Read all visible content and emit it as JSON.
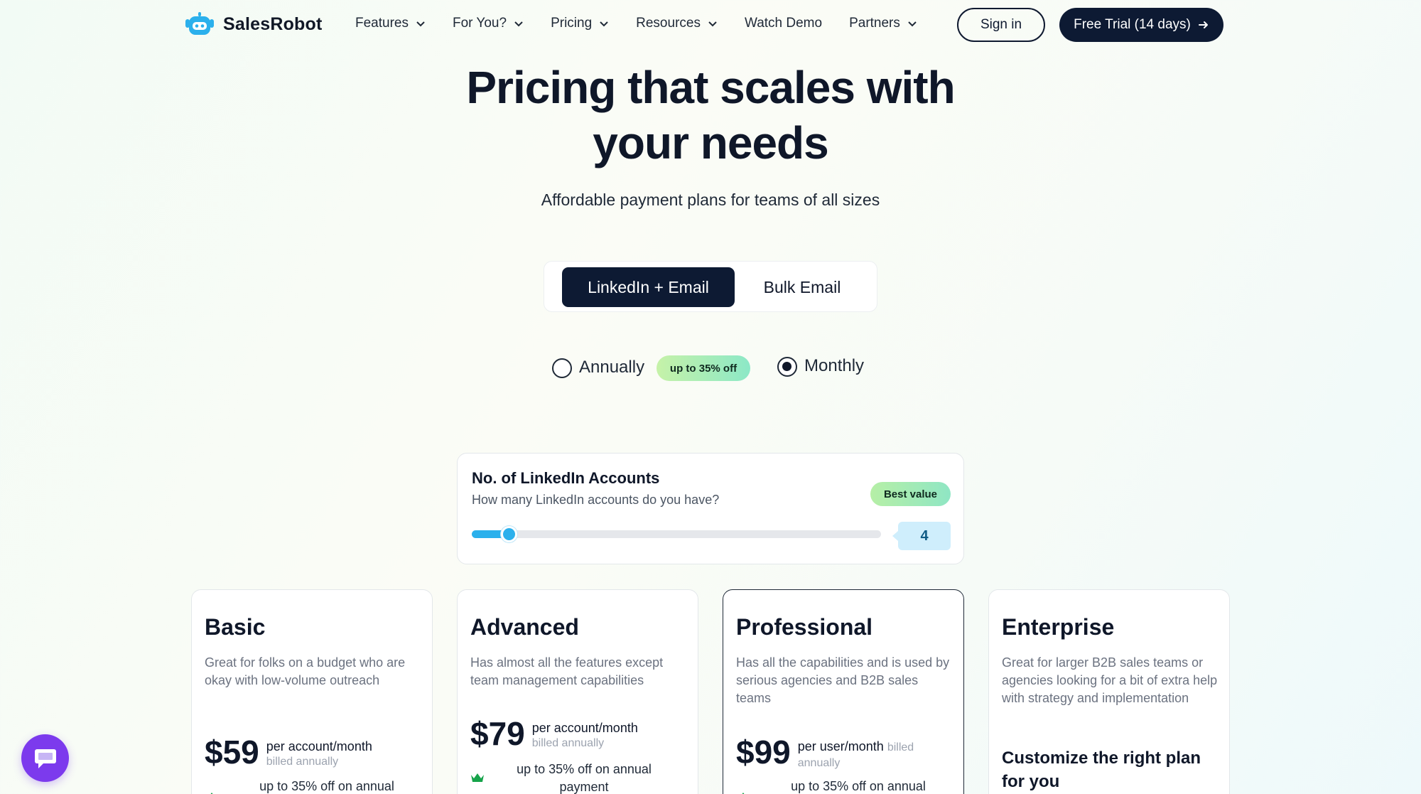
{
  "brand": {
    "name": "SalesRobot",
    "icon": "robot-logo-icon"
  },
  "nav": {
    "items": [
      {
        "label": "Features",
        "dropdown": true
      },
      {
        "label": "For You?",
        "dropdown": true
      },
      {
        "label": "Pricing",
        "dropdown": true
      },
      {
        "label": "Resources",
        "dropdown": true
      },
      {
        "label": "Watch Demo",
        "dropdown": false
      },
      {
        "label": "Partners",
        "dropdown": true
      }
    ],
    "signin_label": "Sign in",
    "trial_label": "Free Trial (14 days)"
  },
  "hero": {
    "title_line1": "Pricing that scales with",
    "title_line2": "your needs",
    "subtitle": "Affordable payment plans for teams of all sizes"
  },
  "product_tabs": {
    "active": "LinkedIn + Email",
    "inactive": "Bulk Email"
  },
  "billing": {
    "annually_label": "Annually",
    "discount_badge": "up to 35% off",
    "monthly_label": "Monthly",
    "selected": "Monthly"
  },
  "accounts": {
    "title": "No. of LinkedIn Accounts",
    "subtitle": "How many LinkedIn accounts do you have?",
    "badge": "Best value",
    "value": "4",
    "slider_fraction": 0.09
  },
  "plans": [
    {
      "name": "Basic",
      "description": "Great for folks on a budget who are okay with low-volume outreach",
      "price": "$59",
      "per": "per account/month",
      "billed": "billed annually",
      "discount_text": "up to 35% off on annual"
    },
    {
      "name": "Advanced",
      "description": "Has almost all the features except team management capabilities",
      "price": "$79",
      "per": "per account/month",
      "billed": "billed annually",
      "discount_text": "up to 35% off on annual payment"
    },
    {
      "name": "Professional",
      "description": "Has all the capabilities and is used by serious agencies and B2B sales teams",
      "price": "$99",
      "per": "per user/month",
      "billed_inline": "billed",
      "billed": "annually",
      "discount_text": "up to 35% off on annual"
    },
    {
      "name": "Enterprise",
      "description": "Great for larger B2B sales teams or agencies looking for a bit of extra help with strategy and implementation",
      "headline": "Customize the right plan for you"
    }
  ],
  "colors": {
    "primary_dark": "#0d1a33",
    "accent_blue": "#2bb0ec",
    "badge_green": "#8ce8c7",
    "chat_purple": "#7c3aed",
    "crown_green": "#16a34a"
  }
}
